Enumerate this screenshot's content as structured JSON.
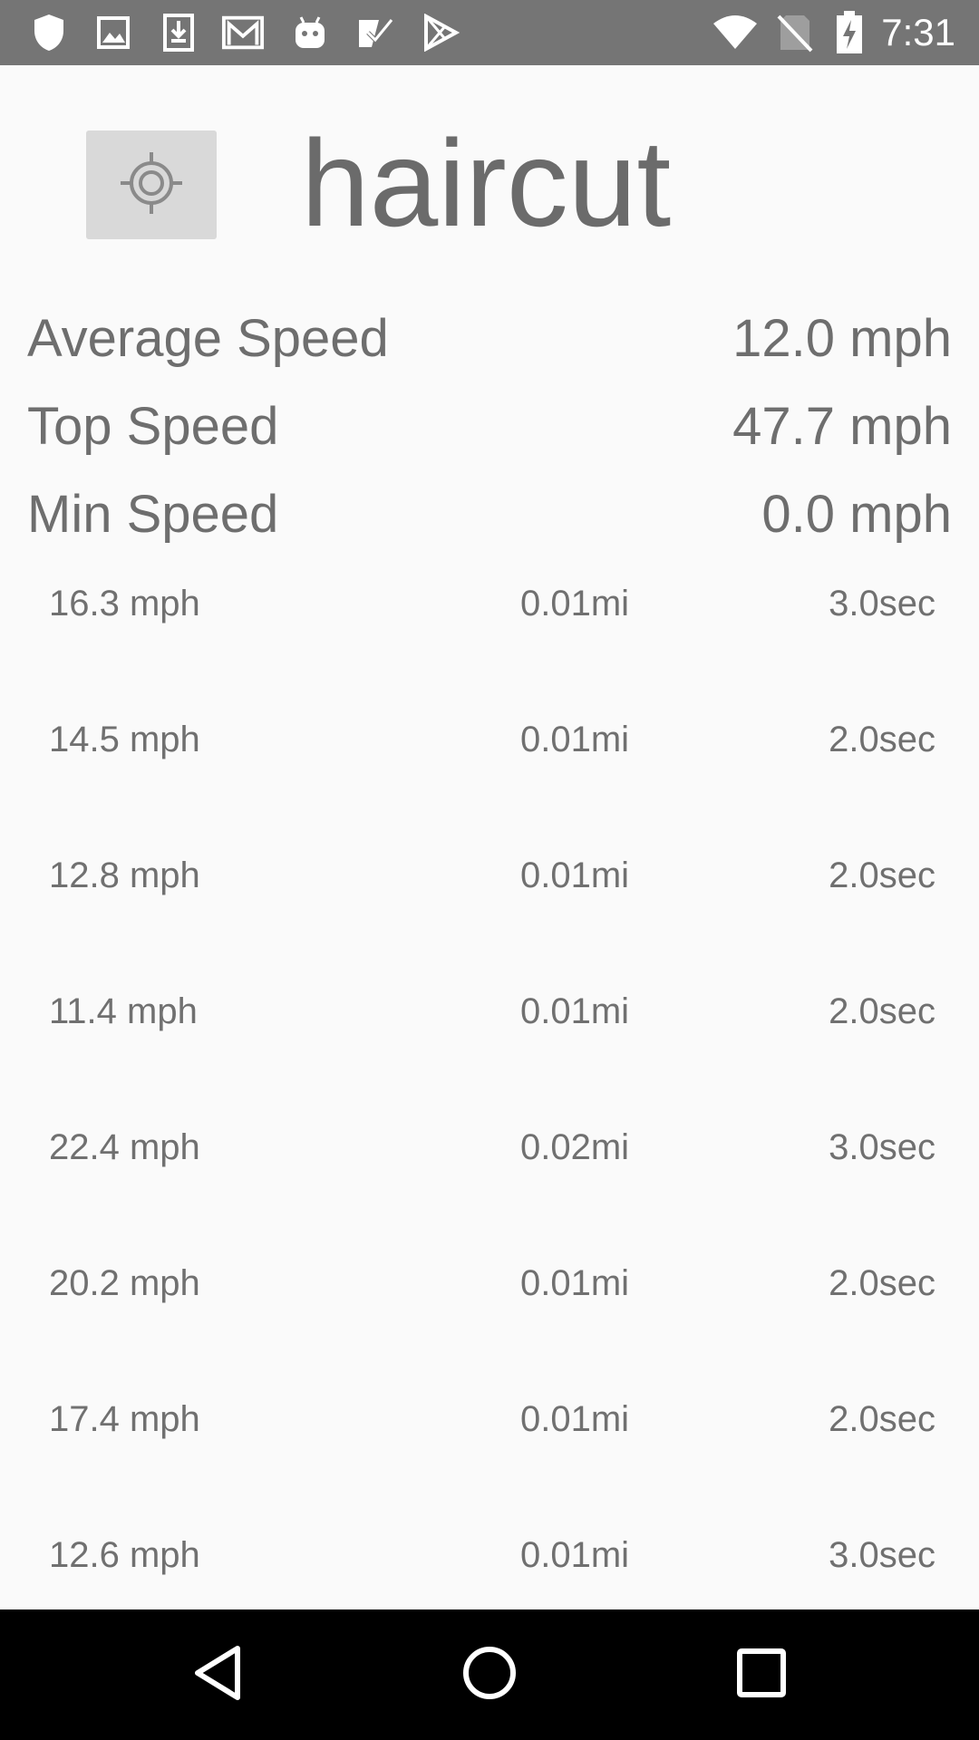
{
  "status_bar": {
    "time": "7:31",
    "left_icons": [
      "shield-icon",
      "image-icon",
      "download-icon",
      "gmail-icon",
      "android-icon",
      "tasks-icon",
      "play-store-icon"
    ],
    "right_icons": [
      "wifi-icon",
      "no-sim-icon",
      "battery-charging-icon"
    ]
  },
  "header": {
    "title": "haircut",
    "locate_icon": "crosshair-icon"
  },
  "stats": [
    {
      "label": "Average Speed",
      "value": "12.0 mph"
    },
    {
      "label": "Top Speed",
      "value": "47.7 mph"
    },
    {
      "label": "Min Speed",
      "value": "0.0 mph"
    }
  ],
  "laps": [
    {
      "speed": "16.3 mph",
      "distance": "0.01mi",
      "time": "3.0sec"
    },
    {
      "speed": "14.5 mph",
      "distance": "0.01mi",
      "time": "2.0sec"
    },
    {
      "speed": "12.8 mph",
      "distance": "0.01mi",
      "time": "2.0sec"
    },
    {
      "speed": "11.4 mph",
      "distance": "0.01mi",
      "time": "2.0sec"
    },
    {
      "speed": "22.4 mph",
      "distance": "0.02mi",
      "time": "3.0sec"
    },
    {
      "speed": "20.2 mph",
      "distance": "0.01mi",
      "time": "2.0sec"
    },
    {
      "speed": "17.4 mph",
      "distance": "0.01mi",
      "time": "2.0sec"
    },
    {
      "speed": "12.6 mph",
      "distance": "0.01mi",
      "time": "3.0sec"
    }
  ],
  "nav_bar": {
    "icons": [
      "back-icon",
      "home-icon",
      "recents-icon"
    ]
  },
  "colors": {
    "status_bar": "#757575",
    "background": "#fafafa",
    "text": "#6e6e6e",
    "button": "#d9d9d9",
    "nav_bar": "#000000"
  }
}
